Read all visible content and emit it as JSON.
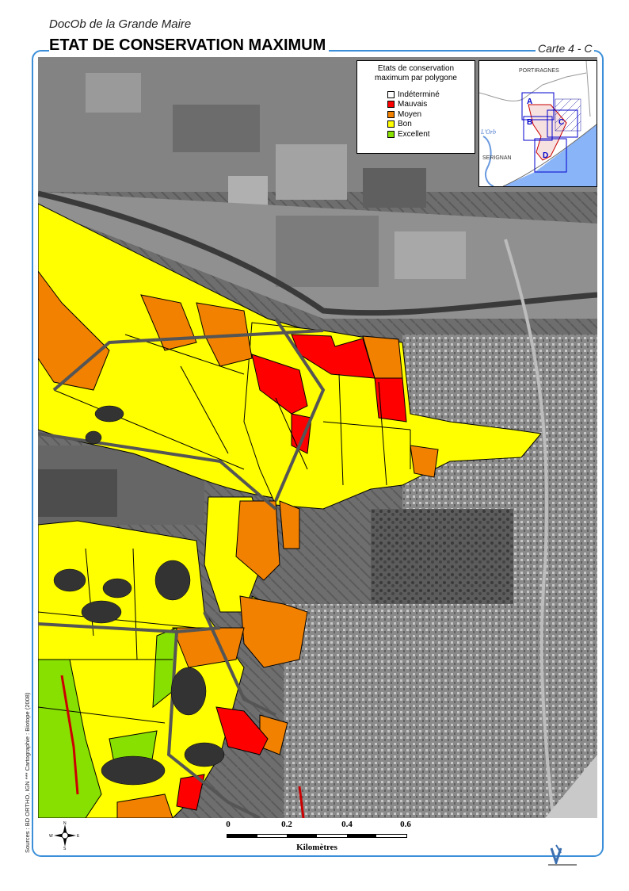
{
  "header": {
    "subtitle": "DocOb de la Grande Maire",
    "title": "ETAT DE CONSERVATION MAXIMUM",
    "map_code": "Carte 4 - C"
  },
  "legend": {
    "title_line1": "Etats de conservation",
    "title_line2": "maximum par polygone",
    "items": [
      {
        "label": "Indéterminé",
        "color": "#ffffff"
      },
      {
        "label": "Mauvais",
        "color": "#ff0000"
      },
      {
        "label": "Moyen",
        "color": "#f28100"
      },
      {
        "label": "Bon",
        "color": "#ffff00"
      },
      {
        "label": "Excellent",
        "color": "#88e000"
      }
    ]
  },
  "inset": {
    "place_north": "PORTIRAGNES",
    "place_west": "SERIGNAN",
    "river": "L'Orb",
    "sectors": [
      "A",
      "B",
      "C",
      "D"
    ],
    "sea_color": "#8ab4f8",
    "frame_color": "#0000cc"
  },
  "scale": {
    "ticks": [
      "0",
      "0.2",
      "0.4",
      "0.6"
    ],
    "unit": "Kilomètres"
  },
  "compass": {
    "n": "N",
    "s": "S",
    "e": "E",
    "w": "W"
  },
  "sources": "Sources : BD ORTHO, IGN  ***  Cartographie : Biotope (2008)",
  "colors": {
    "frame": "#3b8fd9",
    "bon": "#ffff00",
    "moyen": "#f28100",
    "mauvais": "#ff0000",
    "excellent": "#88e000"
  }
}
